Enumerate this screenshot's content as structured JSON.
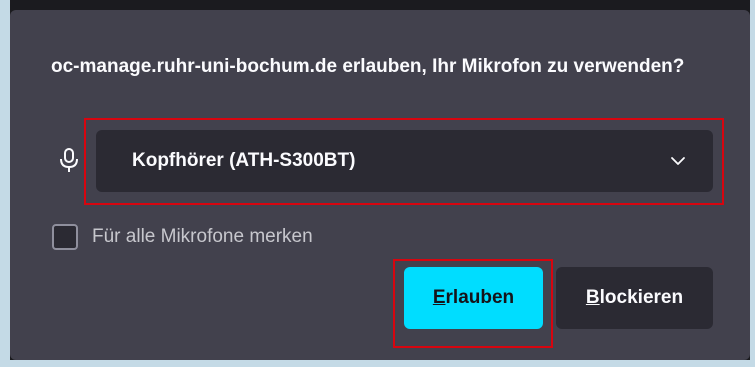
{
  "dialog": {
    "message": "oc-manage.ruhr-uni-bochum.de erlauben, Ihr Mikrofon zu verwenden?"
  },
  "device_select": {
    "icon": "microphone-icon",
    "selected": "Kopfhörer (ATH-S300BT)"
  },
  "remember": {
    "label": "Für alle Mikrofone merken",
    "checked": false
  },
  "buttons": {
    "allow": {
      "access_key": "E",
      "rest": "rlauben"
    },
    "block": {
      "access_key": "B",
      "rest": "lockieren"
    }
  },
  "colors": {
    "dialog_bg": "#42414d",
    "field_bg": "#2b2a33",
    "primary_button": "#00ddff",
    "highlight_box": "#d7050f",
    "page_edge": "#c4dae6"
  }
}
